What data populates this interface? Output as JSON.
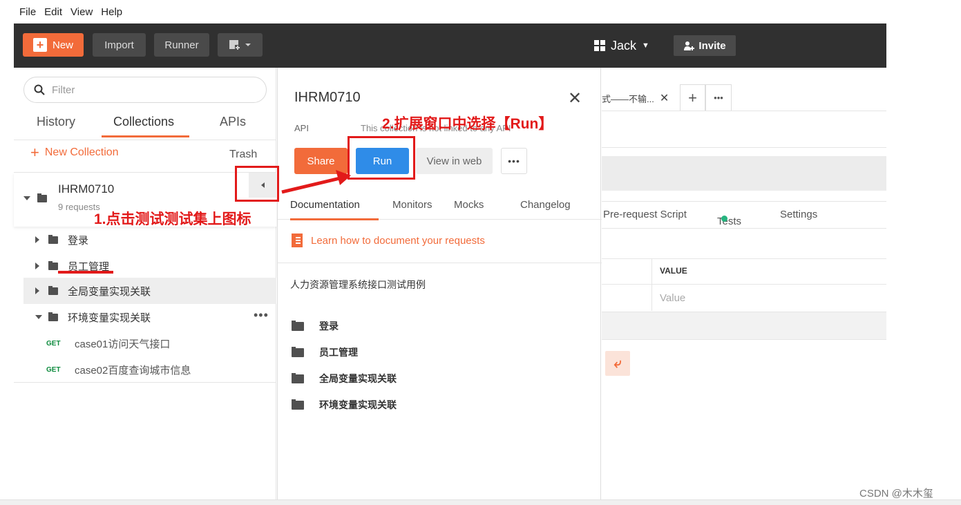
{
  "menu": [
    "File",
    "Edit",
    "View",
    "Help"
  ],
  "toolbar": {
    "new_label": "New",
    "import_label": "Import",
    "runner_label": "Runner",
    "workspace": "Jack",
    "invite_label": "Invite"
  },
  "sidebar": {
    "filter_placeholder": "Filter",
    "tabs": [
      "History",
      "Collections",
      "APIs"
    ],
    "new_collection": "New Collection",
    "trash": "Trash",
    "collection": {
      "name": "IHRM0710",
      "sub": "9 requests"
    },
    "folders": [
      "登录",
      "员工管理",
      "全局变量实现关联",
      "环境变量实现关联"
    ],
    "requests": [
      {
        "method": "GET",
        "name": "case01访问天气接口"
      },
      {
        "method": "GET",
        "name": "case02百度查询城市信息"
      }
    ]
  },
  "panel": {
    "title": "IHRM0710",
    "api": "API",
    "desc": "This collection is not linked to any API",
    "share": "Share",
    "run": "Run",
    "view_in_web": "View in web",
    "tabs": [
      "Documentation",
      "Monitors",
      "Mocks",
      "Changelog"
    ],
    "learn": "Learn how to document your requests",
    "collection_desc": "人力资源管理系统接口测试用例",
    "folders": [
      "登录",
      "员工管理",
      "全局变量实现关联",
      "环境变量实现关联"
    ]
  },
  "right": {
    "tab_label": "式——不输...",
    "subtabs": [
      "Pre-request Script",
      "Tests",
      "Settings"
    ],
    "value_header": "VALUE",
    "value_placeholder": "Value"
  },
  "annotations": {
    "step1": "1.点击测试测试集上图标",
    "step2": "2.扩展窗口中选择【Run】"
  },
  "watermark": "CSDN @木木玺",
  "colors": {
    "accent": "#f26b3a",
    "run_blue": "#2f8ce8",
    "annotation_red": "#e21a1a",
    "toolbar_bg": "#303030"
  }
}
